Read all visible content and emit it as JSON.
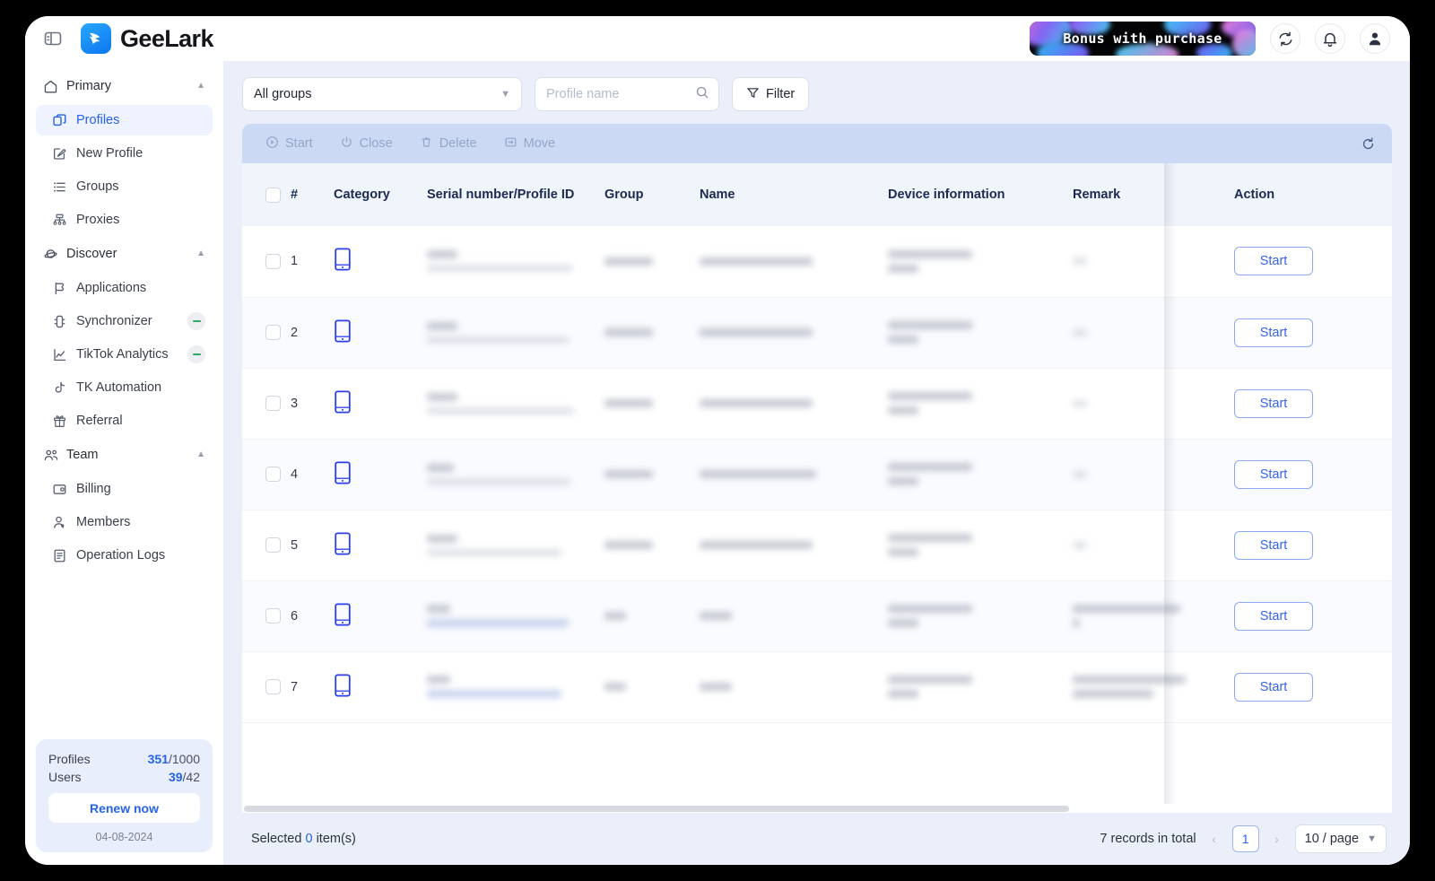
{
  "app": {
    "brand_name": "GeeLark",
    "panel_toggle_icon": "panel-toggle-icon",
    "promo_banner_text": "Bonus with purchase",
    "accent_color": "#2563f0",
    "bulkbar_color": "#ccd9f5",
    "page_bg_color": "#eaeff9"
  },
  "sidebar": {
    "groups": [
      {
        "label": "Primary",
        "icon": "home-icon",
        "expanded": true,
        "items": [
          {
            "label": "Profiles",
            "icon": "profiles-icon",
            "active": true,
            "badge": false
          },
          {
            "label": "New Profile",
            "icon": "new-profile-icon",
            "active": false,
            "badge": false
          },
          {
            "label": "Groups",
            "icon": "groups-list-icon",
            "active": false,
            "badge": false
          },
          {
            "label": "Proxies",
            "icon": "proxies-network-icon",
            "active": false,
            "badge": false
          }
        ]
      },
      {
        "label": "Discover",
        "icon": "discover-planet-icon",
        "expanded": true,
        "items": [
          {
            "label": "Applications",
            "icon": "applications-icon",
            "active": false,
            "badge": false
          },
          {
            "label": "Synchronizer",
            "icon": "synchronizer-icon",
            "active": false,
            "badge": true
          },
          {
            "label": "TikTok Analytics",
            "icon": "analytics-chart-icon",
            "active": false,
            "badge": true
          },
          {
            "label": "TK Automation",
            "icon": "tiktok-note-icon",
            "active": false,
            "badge": false
          },
          {
            "label": "Referral",
            "icon": "gift-icon",
            "active": false,
            "badge": false
          }
        ]
      },
      {
        "label": "Team",
        "icon": "team-people-icon",
        "expanded": true,
        "items": [
          {
            "label": "Billing",
            "icon": "billing-card-icon",
            "active": false,
            "badge": false
          },
          {
            "label": "Members",
            "icon": "member-user-icon",
            "active": false,
            "badge": false
          },
          {
            "label": "Operation Logs",
            "icon": "logs-document-icon",
            "active": false,
            "badge": false
          }
        ]
      }
    ],
    "quota": {
      "profiles_label": "Profiles",
      "profiles_used": "351",
      "profiles_total": "/1000",
      "users_label": "Users",
      "users_used": "39",
      "users_total": "/42",
      "renew_label": "Renew now",
      "expiry_date": "04-08-2024"
    }
  },
  "filters": {
    "group_select_value": "All groups",
    "search_placeholder": "Profile name",
    "search_value": "",
    "filter_button_label": "Filter"
  },
  "bulkbar": {
    "actions": [
      {
        "label": "Start",
        "icon": "play-circle-icon"
      },
      {
        "label": "Close",
        "icon": "power-icon"
      },
      {
        "label": "Delete",
        "icon": "trash-icon"
      },
      {
        "label": "Move",
        "icon": "move-box-icon"
      }
    ],
    "refresh_icon": "refresh-icon"
  },
  "table": {
    "columns": {
      "number": "#",
      "category": "Category",
      "serial": "Serial number/Profile ID",
      "group": "Group",
      "name": "Name",
      "device": "Device information",
      "remark": "Remark",
      "action": "Action",
      "settings_icon": "gear-icon"
    },
    "rows": [
      {
        "num": "1",
        "category_icon": "phone-icon",
        "action_label": "Start",
        "redacted": true,
        "has_remark": false
      },
      {
        "num": "2",
        "category_icon": "phone-icon",
        "action_label": "Start",
        "redacted": true,
        "has_remark": false
      },
      {
        "num": "3",
        "category_icon": "phone-icon",
        "action_label": "Start",
        "redacted": true,
        "has_remark": false
      },
      {
        "num": "4",
        "category_icon": "phone-icon",
        "action_label": "Start",
        "redacted": true,
        "has_remark": false
      },
      {
        "num": "5",
        "category_icon": "phone-icon",
        "action_label": "Start",
        "redacted": true,
        "has_remark": false
      },
      {
        "num": "6",
        "category_icon": "phone-icon",
        "action_label": "Start",
        "redacted": true,
        "has_remark": true
      },
      {
        "num": "7",
        "category_icon": "phone-icon",
        "action_label": "Start",
        "redacted": true,
        "has_remark": true
      }
    ]
  },
  "footer": {
    "selected_prefix": "Selected ",
    "selected_count": "0",
    "selected_suffix": " item(s)",
    "total_records": "7 records in total",
    "prev_arrow": "‹",
    "current_page": "1",
    "next_arrow": "›",
    "page_size": "10 / page"
  }
}
